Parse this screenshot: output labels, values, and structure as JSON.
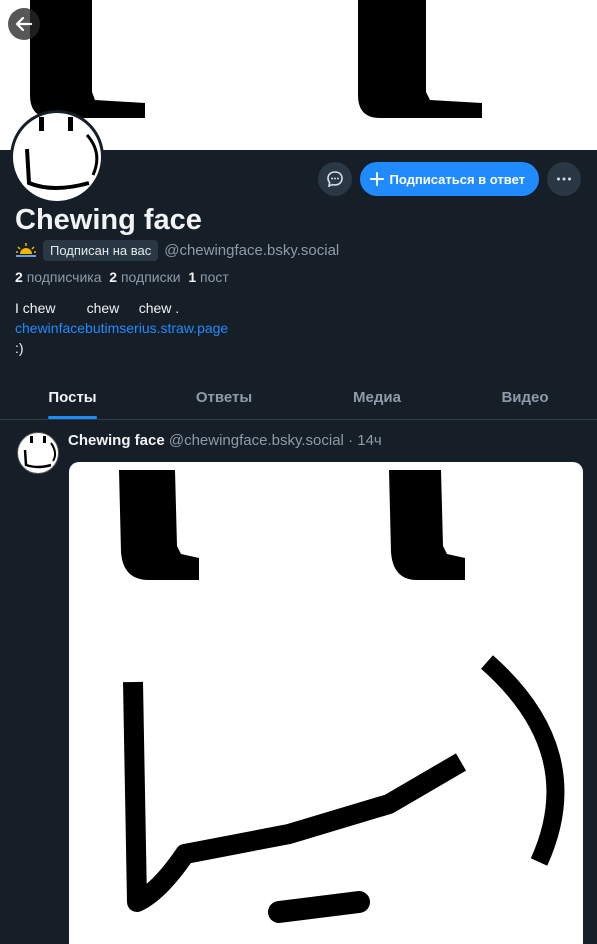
{
  "profile": {
    "display_name": "Chewing face",
    "follows_you": "Подписан на вас",
    "handle": "@chewingface.bsky.social",
    "stats": {
      "followers_count": "2",
      "followers_label": "подписчика",
      "following_count": "2",
      "following_label": "подписки",
      "posts_count": "1",
      "posts_label": "пост"
    },
    "bio": {
      "line1": "I chew        chew     chew .",
      "link": "chewinfacebutimserius.straw.page",
      "line3": ":)"
    }
  },
  "actions": {
    "follow_back_label": "Подписаться в ответ",
    "message_icon": "chat-bubble-icon",
    "more_icon": "ellipsis-icon"
  },
  "tabs": [
    {
      "label": "Посты",
      "active": true
    },
    {
      "label": "Ответы",
      "active": false
    },
    {
      "label": "Медиа",
      "active": false
    },
    {
      "label": "Видео",
      "active": false
    }
  ],
  "post": {
    "author_name": "Chewing face",
    "author_handle": "@chewingface.bsky.social",
    "separator": "·",
    "time": "14ч"
  },
  "colors": {
    "background": "#161e27",
    "accent": "#208bfe",
    "muted_text": "#8d9bab",
    "badge_bg": "#2a3744"
  }
}
